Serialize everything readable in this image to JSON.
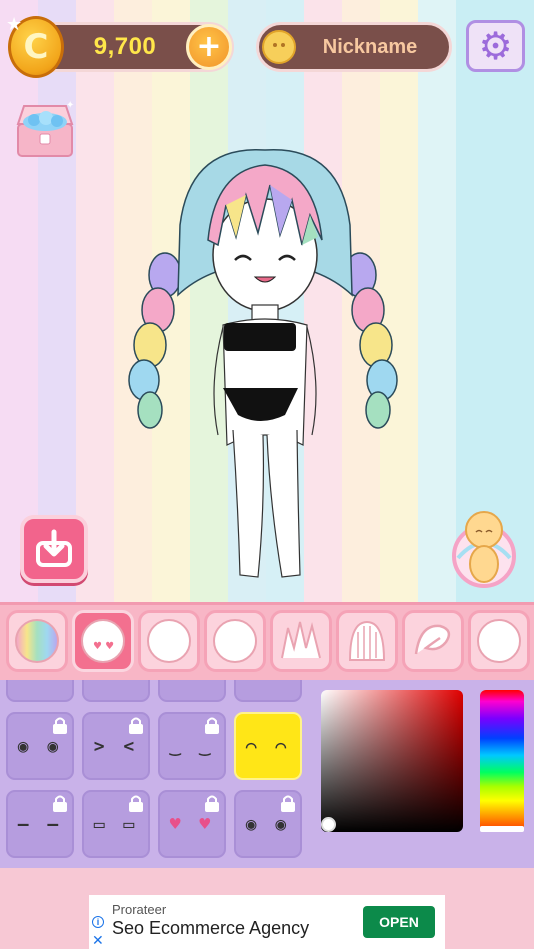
{
  "header": {
    "coins": "9,700",
    "coin_symbol": "C",
    "add_coins_symbol": "+",
    "nickname": "Nickname",
    "settings_symbol": "⚙"
  },
  "category_tabs": [
    {
      "name": "color-rainbow",
      "active": false
    },
    {
      "name": "face-eyes-pink",
      "active": true
    },
    {
      "name": "face-closed",
      "active": false
    },
    {
      "name": "face-mouth",
      "active": false
    },
    {
      "name": "hair-spiky",
      "active": false
    },
    {
      "name": "hair-straight",
      "active": false
    },
    {
      "name": "hair-swirl",
      "active": false
    },
    {
      "name": "face-blank",
      "active": false
    }
  ],
  "expression_tiles": [
    {
      "expr": "◉ ◉",
      "locked": true,
      "selected": false
    },
    {
      "expr": "> <",
      "locked": true,
      "selected": false
    },
    {
      "expr": "‿ ‿",
      "locked": true,
      "selected": false
    },
    {
      "expr": "⌒ ⌒",
      "locked": false,
      "selected": true
    },
    {
      "expr": "— —",
      "locked": true,
      "selected": false
    },
    {
      "expr": "▭ ▭",
      "locked": true,
      "selected": false
    },
    {
      "expr": "♥ ♥",
      "locked": true,
      "selected": false
    },
    {
      "expr": "◉ ◉",
      "locked": true,
      "selected": false
    }
  ],
  "colors": {
    "accent_pink": "#f3708f",
    "panel_purple": "#c9b2e9",
    "selected_yellow": "#ffe617",
    "coin_text": "#ffe64a"
  },
  "ad": {
    "sponsor": "Prorateer",
    "title": "Seo Ecommerce Agency",
    "cta": "OPEN",
    "info_symbol": "i",
    "close_symbol": "✕"
  }
}
